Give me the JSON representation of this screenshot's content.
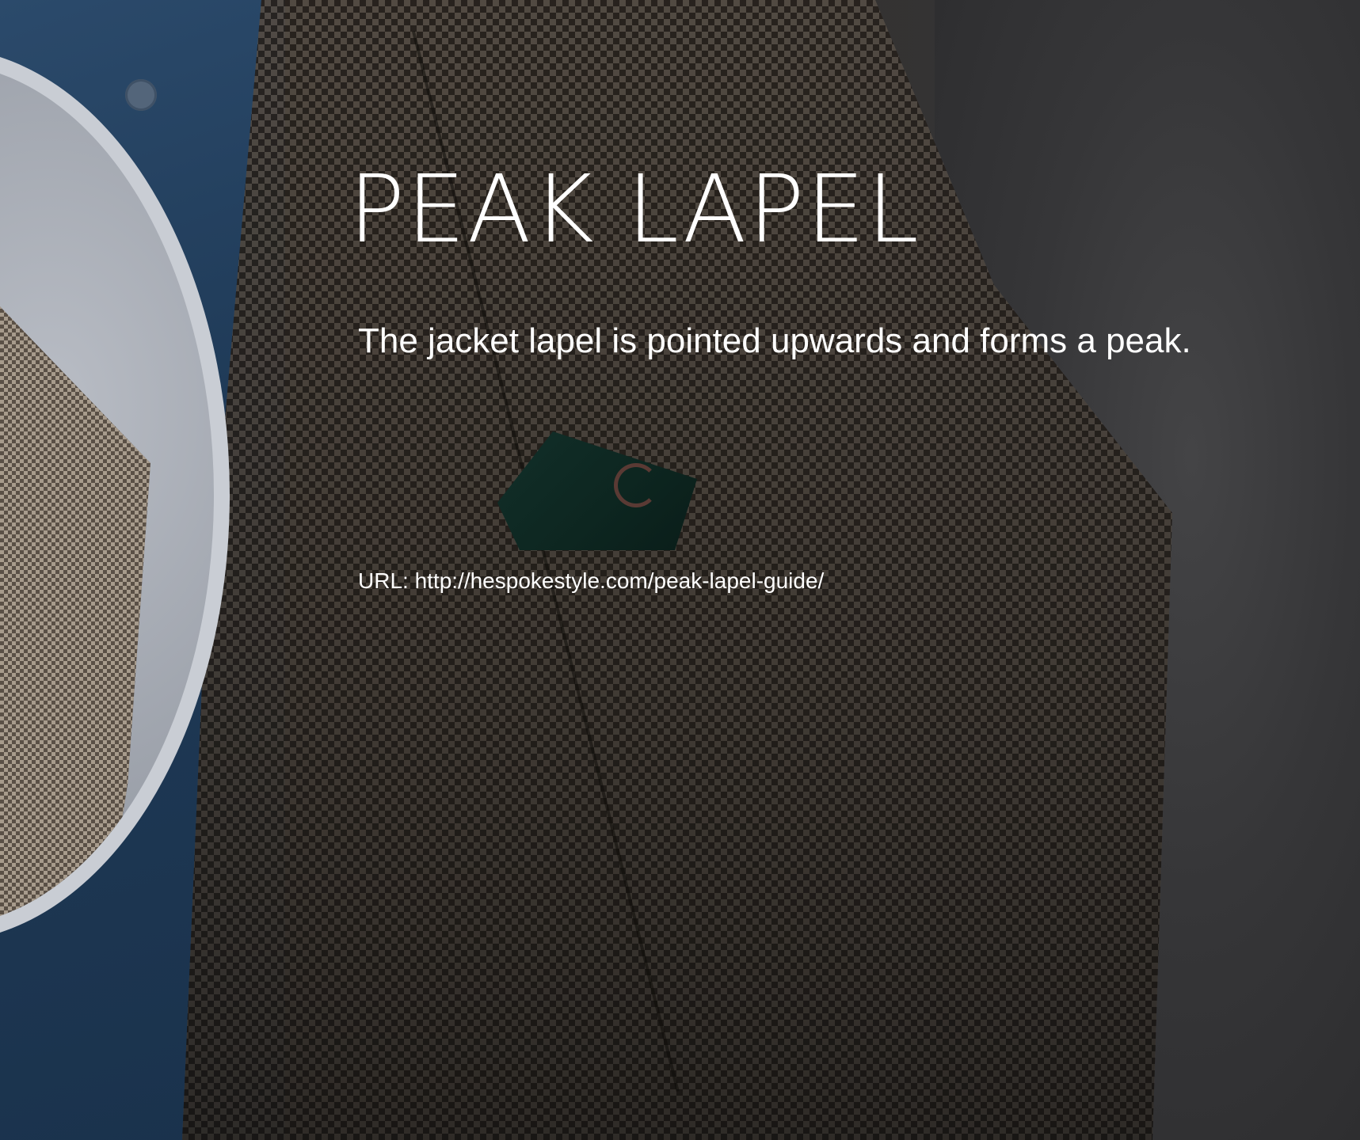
{
  "slide": {
    "title": "PEAK LAPEL",
    "description": "The jacket lapel is pointed upwards and forms a peak.",
    "url_line": "URL: http://hespokestyle.com/peak-lapel-guide/"
  },
  "colors": {
    "text": "#ffffff",
    "background": "#2f2f31",
    "jacket_dark": "#2e2822",
    "jacket_light": "#6b6157",
    "shirt": "#1f3a57",
    "circle_frame": "#c9cdd4",
    "pocket_square": "#0d2620"
  }
}
